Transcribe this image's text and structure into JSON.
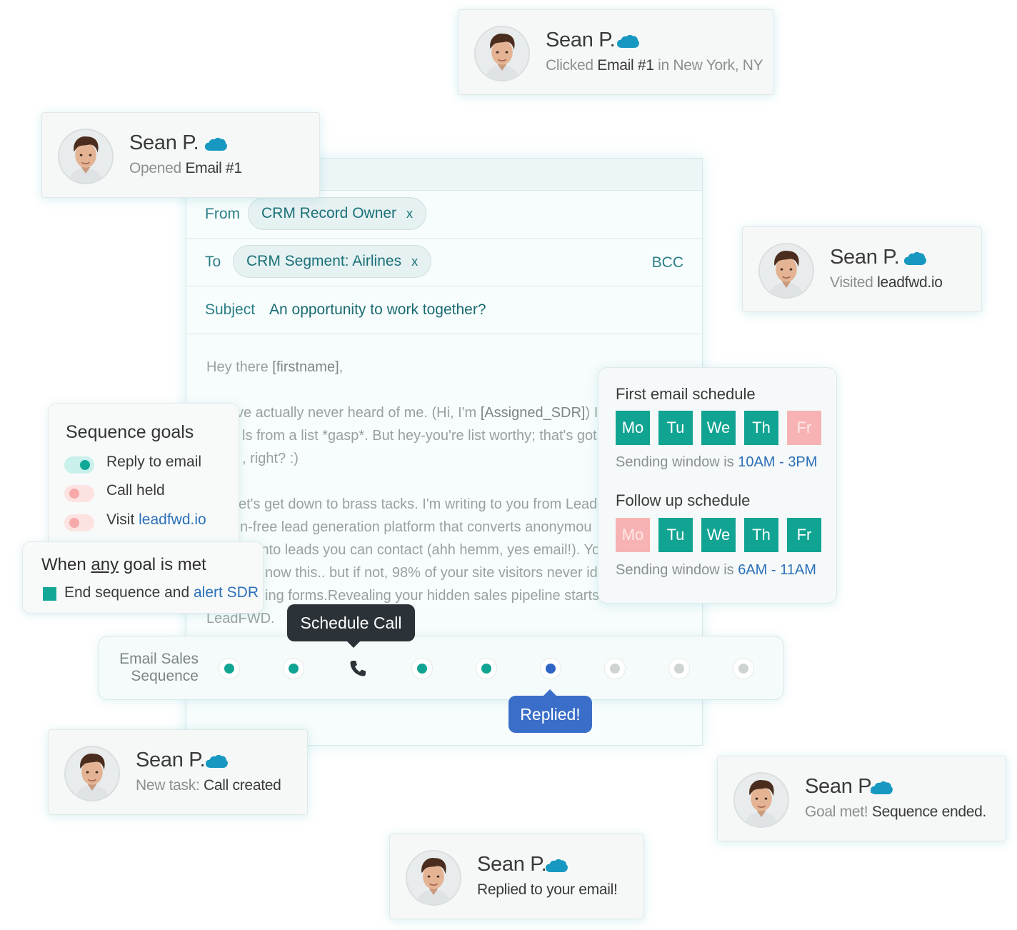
{
  "activity_cards": [
    {
      "name": "Sean P.",
      "status_prefix": "Clicked ",
      "status_highlight": "Email #1",
      "status_suffix": " in New York, NY"
    },
    {
      "name": "Sean P.",
      "status_prefix": "Opened ",
      "status_highlight": "Email #1",
      "status_suffix": ""
    },
    {
      "name": "Sean P.",
      "status_prefix": "Visited ",
      "status_highlight": "leadfwd.io",
      "status_suffix": ""
    },
    {
      "name": "Sean P.",
      "status_prefix": "New task: ",
      "status_highlight": "Call created",
      "status_suffix": ""
    },
    {
      "name": "Sean P.",
      "status_prefix": "Goal met! ",
      "status_highlight": "Sequence ended.",
      "status_suffix": ""
    },
    {
      "name": "Sean P.",
      "status_prefix": "",
      "status_highlight": "Replied to your email!",
      "status_suffix": ""
    }
  ],
  "composer": {
    "from_label": "From",
    "from_chip": "CRM Record Owner",
    "to_label": "To",
    "to_chip": "CRM Segment: Airlines",
    "chip_remove": "x",
    "bcc_label": "BCC",
    "subject_label": "Subject",
    "subject_value": "An opportunity to work together?",
    "body": {
      "greeting_prefix": "Hey there ",
      "greeting_token": "[firstname]",
      "greeting_suffix": ",",
      "p1_l1_a": "ve actually never heard of me. (Hi, I'm ",
      "p1_l1_token": "[Assigned_SDR]",
      "p1_l1_b": ") I g",
      "p1_l2": "ls from a list *gasp*. But hey-you're list worthy; that's got",
      "p1_l3": ", right? :)",
      "p2_l1": "et's get down to brass tacks. I'm writing to you from Lead",
      "p2_l2": "n-free lead generation platform that converts anonymou",
      "p2_l3": "into leads you can contact (ahh hemm, yes email!). Yo",
      "p2_l4": "now this.. but if not, 98% of your site visitors never ide",
      "p2_l5": "ing forms.Revealing your hidden sales pipeline starts",
      "p2_l6": "LeadFWD."
    }
  },
  "goals": {
    "title": "Sequence goals",
    "items": [
      {
        "label": "Reply to email",
        "link": "",
        "enabled": true
      },
      {
        "label": "Call held",
        "link": "",
        "enabled": false
      },
      {
        "label": "Visit ",
        "link": "leadfwd.io",
        "enabled": false
      }
    ]
  },
  "any_goal": {
    "title_a": "When ",
    "title_u": "any",
    "title_b": " goal is met",
    "action_a": "End sequence and ",
    "action_link": "alert SDR"
  },
  "schedule": {
    "first_title": "First email schedule",
    "first_days": [
      {
        "d": "Mo",
        "on": true
      },
      {
        "d": "Tu",
        "on": true
      },
      {
        "d": "We",
        "on": true
      },
      {
        "d": "Th",
        "on": true
      },
      {
        "d": "Fr",
        "on": false
      }
    ],
    "first_window_prefix": "Sending window is ",
    "first_window_time": "10AM - 3PM",
    "follow_title": "Follow up schedule",
    "follow_days": [
      {
        "d": "Mo",
        "on": false
      },
      {
        "d": "Tu",
        "on": true
      },
      {
        "d": "We",
        "on": true
      },
      {
        "d": "Th",
        "on": true
      },
      {
        "d": "Fr",
        "on": true
      }
    ],
    "follow_window_prefix": "Sending window is ",
    "follow_window_time": "6AM - 11AM"
  },
  "sequence": {
    "label_line1": "Email Sales",
    "label_line2": "Sequence",
    "steps": [
      "done",
      "done",
      "call",
      "done",
      "done",
      "current",
      "pending",
      "pending",
      "pending"
    ],
    "call_tooltip": "Schedule Call",
    "replied_tooltip": "Replied!"
  },
  "colors": {
    "accent_teal": "#12a493",
    "link_blue": "#2b6fb8",
    "replied_blue": "#3a6ec9",
    "tooltip_dark": "#2b3238",
    "off_pink": "#f7b3b3",
    "salesforce_blue": "#1798c1"
  },
  "icons": {
    "cloud": "salesforce-cloud-icon",
    "phone": "phone-icon"
  }
}
